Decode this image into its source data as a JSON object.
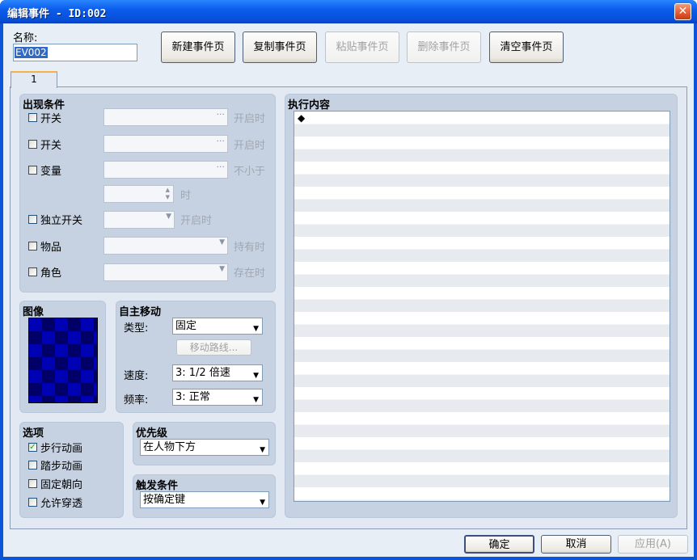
{
  "window": {
    "title": "编辑事件 - ID:002",
    "close_glyph": "✕"
  },
  "name": {
    "label": "名称:",
    "value": "EV002"
  },
  "toolbar": {
    "new_page": "新建事件页",
    "copy_page": "复制事件页",
    "paste_page": "粘贴事件页",
    "delete_page": "删除事件页",
    "clear_page": "清空事件页"
  },
  "tabs": [
    {
      "label": "1"
    }
  ],
  "conditions": {
    "title": "出现条件",
    "switch1": {
      "label": "开关",
      "suffix": "开启时"
    },
    "switch2": {
      "label": "开关",
      "suffix": "开启时"
    },
    "variable": {
      "label": "变量",
      "suffix": "不小于",
      "unit": "时"
    },
    "self_switch": {
      "label": "独立开关",
      "suffix": "开启时"
    },
    "item": {
      "label": "物品",
      "suffix": "持有时"
    },
    "actor": {
      "label": "角色",
      "suffix": "存在时"
    }
  },
  "image": {
    "title": "图像"
  },
  "movement": {
    "title": "自主移动",
    "type_label": "类型:",
    "type_value": "固定",
    "route_button": "移动路线...",
    "speed_label": "速度:",
    "speed_value": "3: 1/2 倍速",
    "freq_label": "频率:",
    "freq_value": "3: 正常"
  },
  "options": {
    "title": "选项",
    "items": [
      {
        "label": "步行动画",
        "checked": true
      },
      {
        "label": "踏步动画",
        "checked": false
      },
      {
        "label": "固定朝向",
        "checked": false
      },
      {
        "label": "允许穿透",
        "checked": false
      }
    ]
  },
  "priority": {
    "title": "优先级",
    "value": "在人物下方"
  },
  "trigger": {
    "title": "触发条件",
    "value": "按确定键"
  },
  "contents": {
    "title": "执行内容",
    "first_line": "◆"
  },
  "footer": {
    "ok": "确定",
    "cancel": "取消",
    "apply": "应用(A)"
  },
  "colors": {
    "titlebar": "#0b5cec",
    "panel": "#c6d2e2",
    "tile_dark": "#000066",
    "tile_light": "#0000b4"
  }
}
